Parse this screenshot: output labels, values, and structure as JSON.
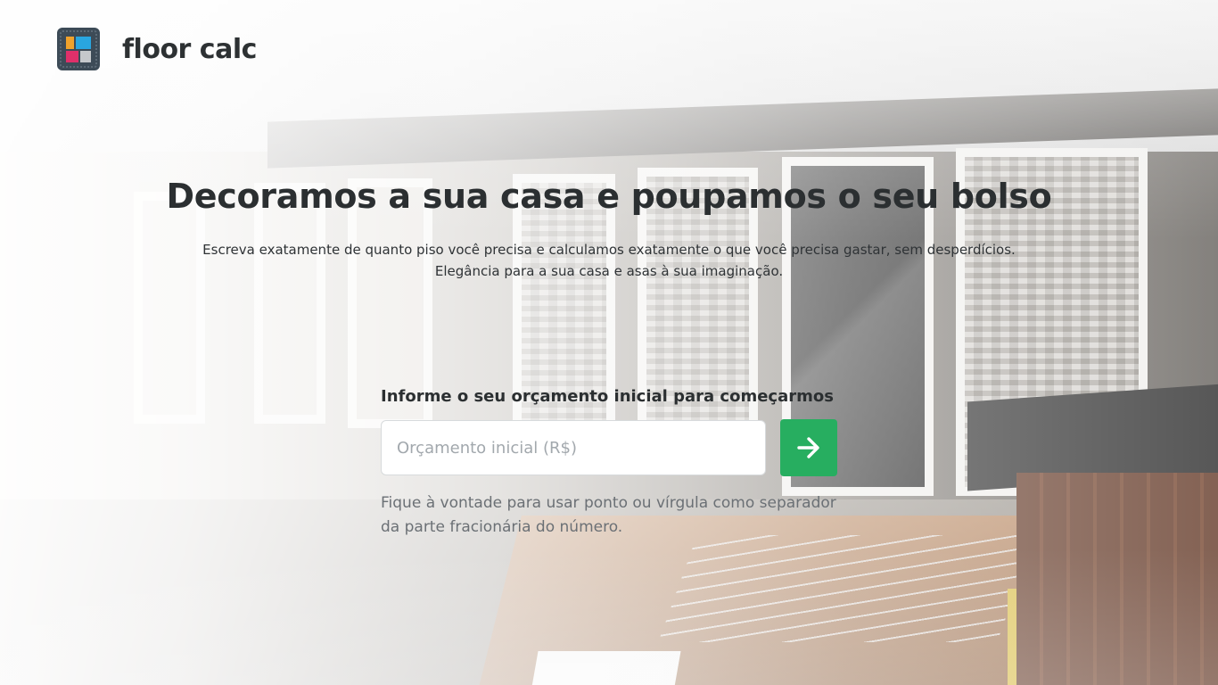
{
  "brand": {
    "name": "floor calc",
    "logo_icon": "tile-mosaic-logo-icon",
    "logo_colors": [
      "#3d4b57",
      "#f0a22c",
      "#29a6e0",
      "#e0306a",
      "#c5c8cb"
    ]
  },
  "hero": {
    "title": "Decoramos a sua casa e poupamos o seu bolso",
    "subtitle_line1": "Escreva exatamente de quanto piso você precisa e calculamos exatamente o que você precisa gastar, sem desperdícios.",
    "subtitle_line2": "Elegância para a sua casa e asas à sua imaginação."
  },
  "form": {
    "label": "Informe o seu orçamento inicial para começarmos",
    "input_value": "",
    "input_placeholder": "Orçamento inicial (R$)",
    "submit_icon": "arrow-right-icon",
    "hint_line1": "Fique à vontade para usar ponto ou vírgula como separador",
    "hint_line2": "da parte fracionária do número."
  },
  "colors": {
    "accent": "#27ae60",
    "text_dark": "#2b2f31",
    "text_muted": "#6b7075"
  }
}
